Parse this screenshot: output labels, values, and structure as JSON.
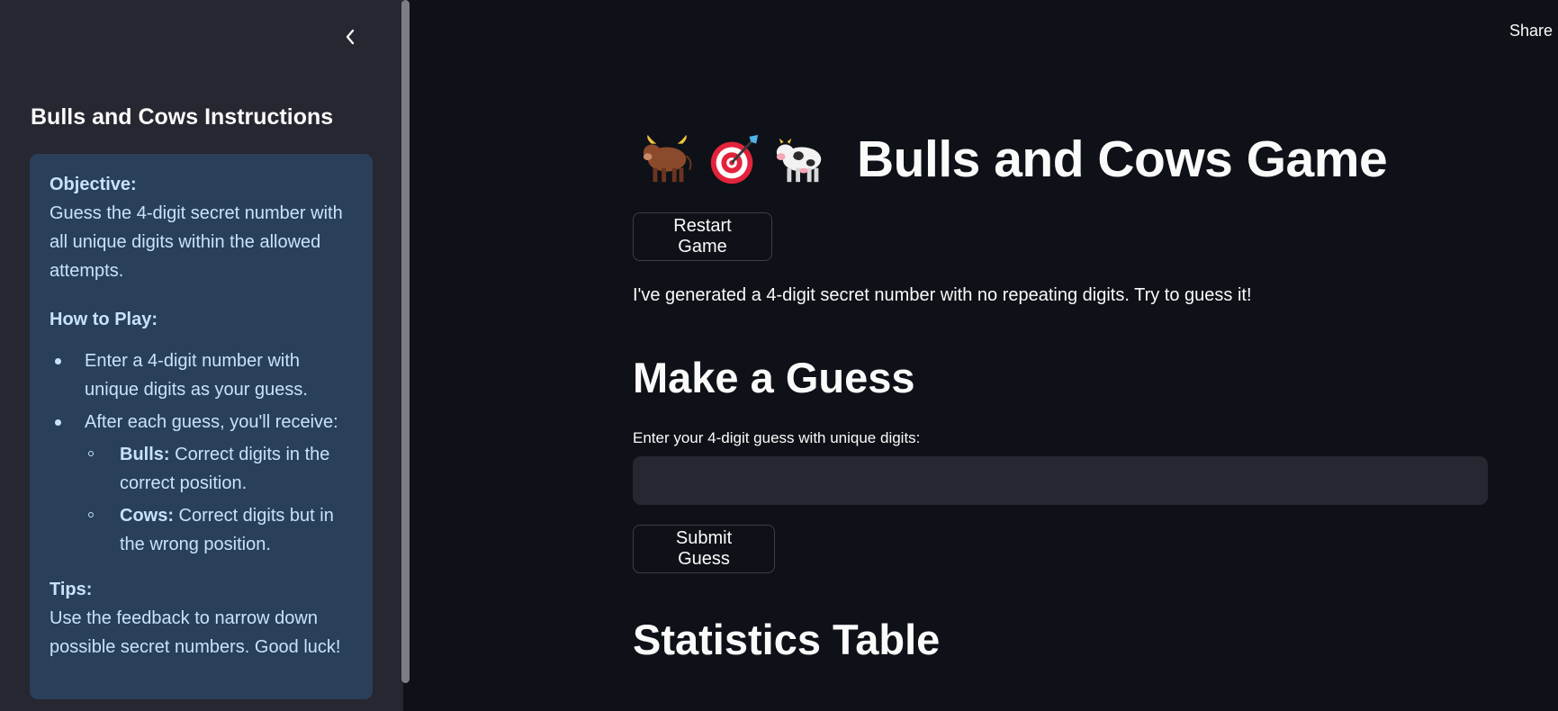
{
  "header": {
    "share_label": "Share"
  },
  "sidebar": {
    "title": "Bulls and Cows Instructions",
    "objective": {
      "heading": "Objective:",
      "text": "Guess the 4-digit secret number with all unique digits within the allowed attempts."
    },
    "how_to_play": {
      "heading": "How to Play:",
      "items": [
        "Enter a 4-digit number with unique digits as your guess.",
        "After each guess, you'll receive:"
      ],
      "feedback": [
        {
          "term": "Bulls:",
          "desc": " Correct digits in the correct position."
        },
        {
          "term": "Cows:",
          "desc": " Correct digits but in the wrong position."
        }
      ]
    },
    "tips": {
      "heading": "Tips:",
      "text": "Use the feedback to narrow down possible secret numbers. Good luck!"
    }
  },
  "main": {
    "title": "Bulls and Cows Game",
    "title_icons": [
      "bull-icon",
      "target-icon",
      "cow-icon"
    ],
    "restart_label": "Restart Game",
    "intro": "I've generated a 4-digit secret number with no repeating digits. Try to guess it!",
    "guess_heading": "Make a Guess",
    "guess_label": "Enter your 4-digit guess with unique digits:",
    "guess_value": "",
    "submit_label": "Submit Guess",
    "stats_heading": "Statistics Table"
  },
  "colors": {
    "background": "#0e1117",
    "sidebar": "#262730",
    "info_box": "#2a3f5a",
    "info_text": "#c7e3fb",
    "input": "#262730"
  }
}
